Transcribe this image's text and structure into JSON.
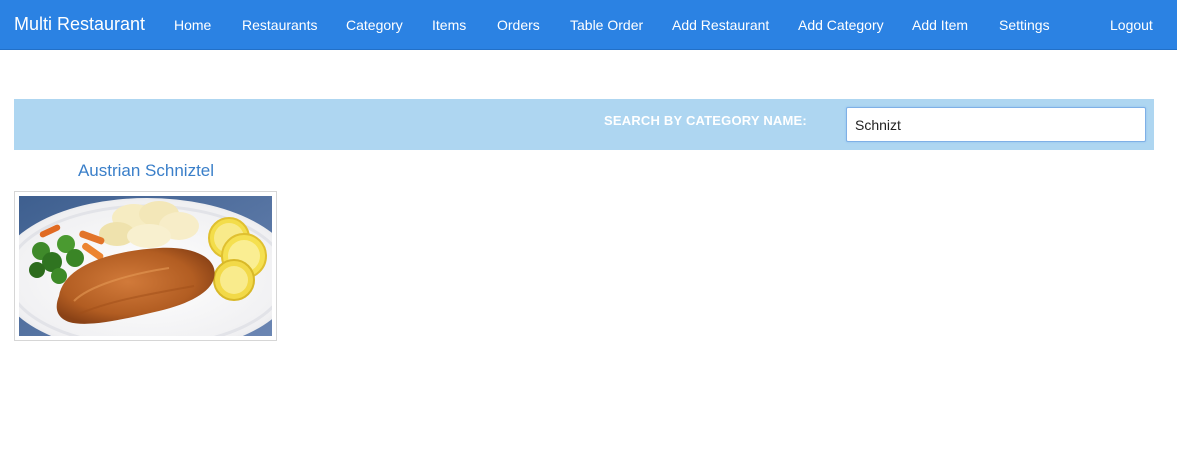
{
  "app": {
    "brand": "Multi Restaurant"
  },
  "nav": {
    "items": [
      {
        "label": "Home"
      },
      {
        "label": "Restaurants"
      },
      {
        "label": "Category"
      },
      {
        "label": "Items"
      },
      {
        "label": "Orders"
      },
      {
        "label": "Table Order"
      },
      {
        "label": "Add Restaurant"
      },
      {
        "label": "Add Category"
      },
      {
        "label": "Add Item"
      },
      {
        "label": "Settings"
      }
    ],
    "logout": "Logout"
  },
  "search": {
    "label": "SEARCH BY CATEGORY NAME:",
    "value": "Schnizt"
  },
  "results": [
    {
      "title": "Austrian Schniztel",
      "image": "schnitzel-plate"
    }
  ],
  "colors": {
    "navbar": "#2b82e3",
    "search_bar": "#aed6f1",
    "link": "#3a7fc9"
  }
}
